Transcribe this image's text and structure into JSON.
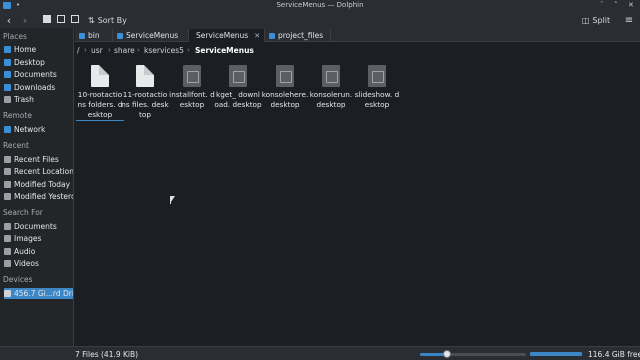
{
  "window": {
    "title": "ServiceMenus — Dolphin",
    "pin_icon": "•",
    "minimize": "ˇ",
    "maximize": "˄",
    "close": "✕"
  },
  "toolbar": {
    "back": "‹",
    "forward": "›",
    "sort_label": "Sort By",
    "split_label": "Split",
    "menu_icon": "≡"
  },
  "sidebar": {
    "places_header": "Places",
    "places": [
      {
        "label": "Home",
        "icon": "home-icon",
        "color": "#3b8fd6"
      },
      {
        "label": "Desktop",
        "icon": "desktop-icon",
        "color": "#3b8fd6"
      },
      {
        "label": "Documents",
        "icon": "documents-icon",
        "color": "#3b8fd6"
      },
      {
        "label": "Downloads",
        "icon": "downloads-icon",
        "color": "#3b8fd6"
      },
      {
        "label": "Trash",
        "icon": "trash-icon",
        "color": "#9aa0a6"
      }
    ],
    "remote_header": "Remote",
    "remote": [
      {
        "label": "Network",
        "icon": "network-icon",
        "color": "#3b8fd6"
      }
    ],
    "recent_header": "Recent",
    "recent": [
      {
        "label": "Recent Files",
        "icon": "recent-files-icon",
        "color": "#9aa0a6"
      },
      {
        "label": "Recent Locations",
        "icon": "recent-locations-icon",
        "color": "#9aa0a6"
      },
      {
        "label": "Modified Today",
        "icon": "calendar-icon",
        "color": "#9aa0a6"
      },
      {
        "label": "Modified Yesterday",
        "icon": "calendar-icon",
        "color": "#9aa0a6"
      }
    ],
    "search_header": "Search For",
    "search": [
      {
        "label": "Documents",
        "icon": "documents-search-icon",
        "color": "#9aa0a6"
      },
      {
        "label": "Images",
        "icon": "images-icon",
        "color": "#9aa0a6"
      },
      {
        "label": "Audio",
        "icon": "audio-icon",
        "color": "#9aa0a6"
      },
      {
        "label": "Videos",
        "icon": "videos-icon",
        "color": "#9aa0a6"
      }
    ],
    "devices_header": "Devices",
    "devices": [
      {
        "label": "456.7 Gi...rd Drive",
        "icon": "hard-drive-icon",
        "color": "#9aa0a6"
      }
    ]
  },
  "tabs": [
    {
      "label": "bin",
      "active": false
    },
    {
      "label": "ServiceMenus",
      "active": false
    },
    {
      "label": "ServiceMenus",
      "active": true
    },
    {
      "label": "project_files",
      "active": false
    }
  ],
  "tab_close": "✕",
  "breadcrumb": {
    "root": "/",
    "parts": [
      "usr",
      "share",
      "kservices5"
    ],
    "current": "ServiceMenus",
    "separator": "›"
  },
  "files": [
    {
      "name": "10-rootactions folders. desktop",
      "type": "blank"
    },
    {
      "name": "11-rootactions files. desktop",
      "type": "blank"
    },
    {
      "name": "installfont. desktop",
      "type": "app"
    },
    {
      "name": "kget_ download. desktop",
      "type": "app"
    },
    {
      "name": "konsolehere.desktop",
      "type": "app"
    },
    {
      "name": "konsolerun. desktop",
      "type": "app"
    },
    {
      "name": "slideshow. desktop",
      "type": "app"
    }
  ],
  "status": {
    "summary": "7 Files (41.9 KiB)",
    "free_space": "116.4 GiB free",
    "zoom_fraction": 0.25
  },
  "colors": {
    "accent": "#3d86c6",
    "background": "#1b1e22",
    "panel": "#232629"
  }
}
